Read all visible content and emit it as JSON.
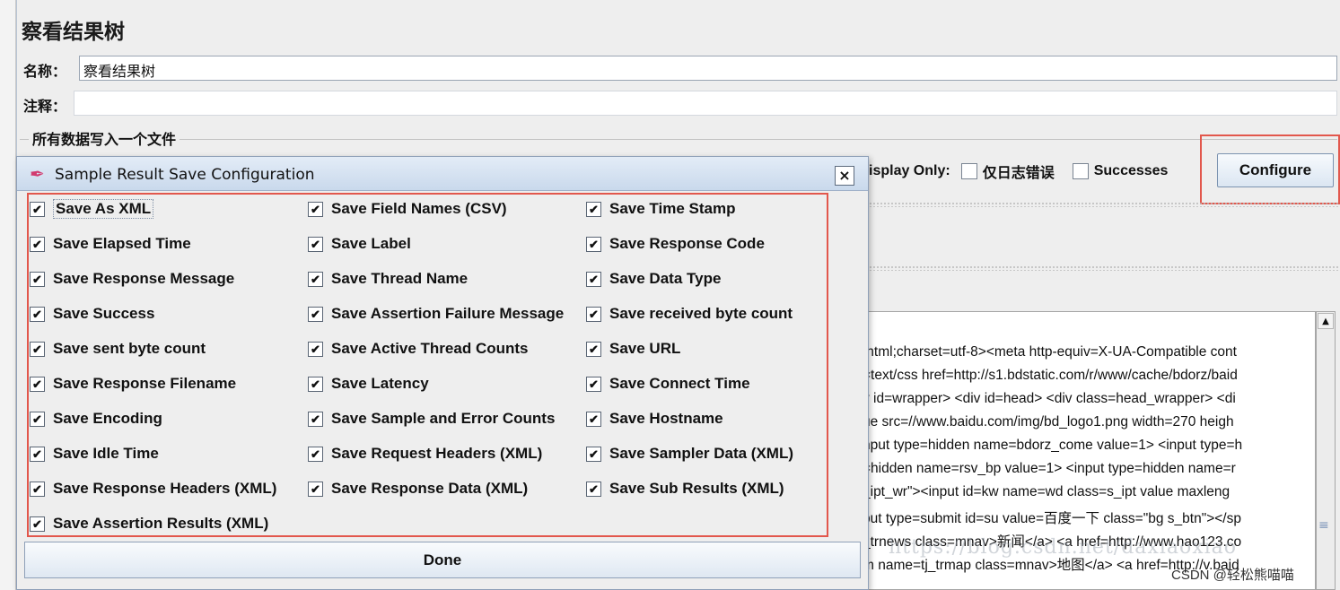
{
  "panel": {
    "title": "察看结果树",
    "name_label": "名称：",
    "name_value": "察看结果树",
    "comment_label": "注释：",
    "comment_value": "",
    "file_group_title": "所有数据写入一个文件",
    "display_only_label": "isplay Only:",
    "log_errors_label": "仅日志错误",
    "successes_label": "Successes",
    "configure_label": "Configure"
  },
  "response_lines": [
    "/html;charset=utf-8><meta http-equiv=X-UA-Compatible cont",
    "=text/css href=http://s1.bdstatic.com/r/www/cache/bdorz/baid",
    "v id=wrapper> <div id=head> <div class=head_wrapper> <di",
    "ue src=//www.baidu.com/img/bd_logo1.png width=270 heigh",
    "nput type=hidden name=bdorz_come value=1> <input type=h",
    "=hidden name=rsv_bp value=1> <input type=hidden name=r",
    "_ipt_wr\"><input id=kw name=wd class=s_ipt value maxleng",
    "put type=submit id=su value=百度一下 class=\"bg s_btn\"></sp",
    "_trnews class=mnav>新闻</a> <a href=http://www.hao123.co",
    "m name=tj_trmap class=mnav>地图</a> <a href=http://v.baid"
  ],
  "watermark": {
    "url": "https://blog.csdn.net/daxiaoxiao",
    "csdn": "CSDN @轻松熊喵喵"
  },
  "dialog": {
    "title": "Sample Result Save Configuration",
    "close_glyph": "×",
    "done_label": "Done",
    "options": [
      [
        "Save As XML",
        "Save Field Names (CSV)",
        "Save Time Stamp"
      ],
      [
        "Save Elapsed Time",
        "Save Label",
        "Save Response Code"
      ],
      [
        "Save Response Message",
        "Save Thread Name",
        "Save Data Type"
      ],
      [
        "Save Success",
        "Save Assertion Failure Message",
        "Save received byte count"
      ],
      [
        "Save sent byte count",
        "Save Active Thread Counts",
        "Save URL"
      ],
      [
        "Save Response Filename",
        "Save Latency",
        "Save Connect Time"
      ],
      [
        "Save Encoding",
        "Save Sample and Error Counts",
        "Save Hostname"
      ],
      [
        "Save Idle Time",
        "Save Request Headers (XML)",
        "Save Sampler Data (XML)"
      ],
      [
        "Save Response Headers (XML)",
        "Save Response Data (XML)",
        "Save Sub Results (XML)"
      ],
      [
        "Save Assertion Results (XML)"
      ]
    ],
    "checked": true
  },
  "colors": {
    "highlight": "#e2574c",
    "titlebar": "#c9d9ec"
  },
  "icons": {
    "dialog_icon": "feather-icon",
    "checkbox": "checkmark-icon"
  }
}
